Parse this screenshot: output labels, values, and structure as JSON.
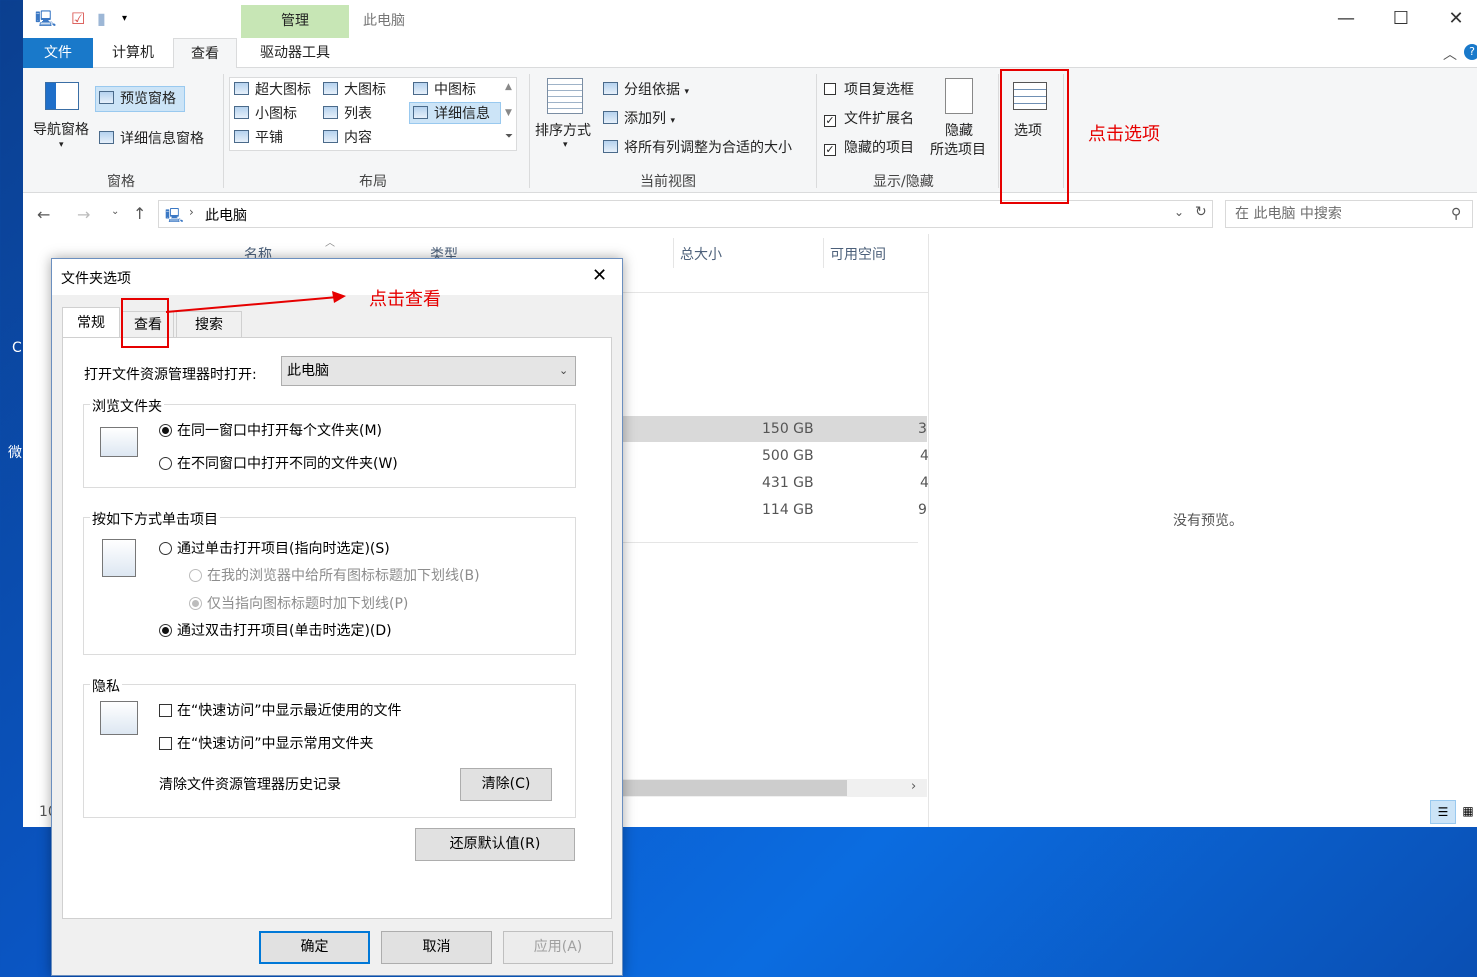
{
  "explorer": {
    "title": "此电脑",
    "context_tab": "管理",
    "tabs": [
      "文件",
      "计算机",
      "查看",
      "驱动器工具"
    ],
    "ribbon": {
      "panes": {
        "nav_pane": "导航窗格",
        "preview_pane": "预览窗格",
        "details_pane": "详细信息窗格",
        "group": "窗格"
      },
      "layout": {
        "items": [
          "超大图标",
          "大图标",
          "中图标",
          "小图标",
          "列表",
          "详细信息",
          "平铺",
          "内容"
        ],
        "group": "布局"
      },
      "current_view": {
        "sort_by": "排序方式",
        "group_by": "分组依据",
        "add_column": "添加列",
        "fit_columns": "将所有列调整为合适的大小",
        "group": "当前视图"
      },
      "show_hide": {
        "item_checkboxes": "项目复选框",
        "file_extensions": "文件扩展名",
        "hidden_items": "隐藏的项目",
        "hide_selected_line1": "隐藏",
        "hide_selected_line2": "所选项目",
        "group": "显示/隐藏"
      },
      "options": "选项"
    },
    "address": "此电脑",
    "search_placeholder": "在 此电脑 中搜索",
    "columns": [
      "名称",
      "类型",
      "总大小",
      "可用空间"
    ],
    "rows": [
      {
        "total": "150 GB",
        "free": "3"
      },
      {
        "total": "500 GB",
        "free": "4"
      },
      {
        "total": "431 GB",
        "free": "4"
      },
      {
        "total": "114 GB",
        "free": "9"
      }
    ],
    "preview_text": "没有预览。",
    "status_fragment": "10"
  },
  "annotations": {
    "click_options": "点击选项",
    "click_view": "点击查看"
  },
  "dialog": {
    "title": "文件夹选项",
    "tabs": [
      "常规",
      "查看",
      "搜索"
    ],
    "open_in_label": "打开文件资源管理器时打开:",
    "open_in_value": "此电脑",
    "browse": {
      "legend": "浏览文件夹",
      "same_window": "在同一窗口中打开每个文件夹(M)",
      "new_window": "在不同窗口中打开不同的文件夹(W)"
    },
    "click": {
      "legend": "按如下方式单击项目",
      "single": "通过单击打开项目(指向时选定)(S)",
      "underline_all": "在我的浏览器中给所有图标标题加下划线(B)",
      "underline_point": "仅当指向图标标题时加下划线(P)",
      "double": "通过双击打开项目(单击时选定)(D)"
    },
    "privacy": {
      "legend": "隐私",
      "recent_files": "在“快速访问”中显示最近使用的文件",
      "frequent_folders": "在“快速访问”中显示常用文件夹",
      "clear_label": "清除文件资源管理器历史记录",
      "clear_button": "清除(C)"
    },
    "restore_defaults": "还原默认值(R)",
    "ok": "确定",
    "cancel": "取消",
    "apply": "应用(A)"
  }
}
